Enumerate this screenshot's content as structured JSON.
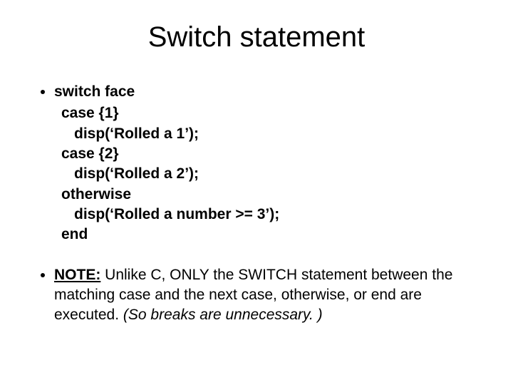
{
  "title": "Switch statement",
  "code": {
    "l0": "switch face",
    "l1": "case {1}",
    "l2": "disp(‘Rolled a 1’);",
    "l3": "case {2}",
    "l4": "disp(‘Rolled a 2’);",
    "l5": "otherwise",
    "l6": "disp(‘Rolled a number >= 3’);",
    "l7": "end"
  },
  "note": {
    "label": "NOTE:",
    "body": "  Unlike C, ONLY the SWITCH statement between the matching case and the next case, otherwise, or end are executed.  ",
    "tail": "(So breaks are unnecessary. )"
  }
}
